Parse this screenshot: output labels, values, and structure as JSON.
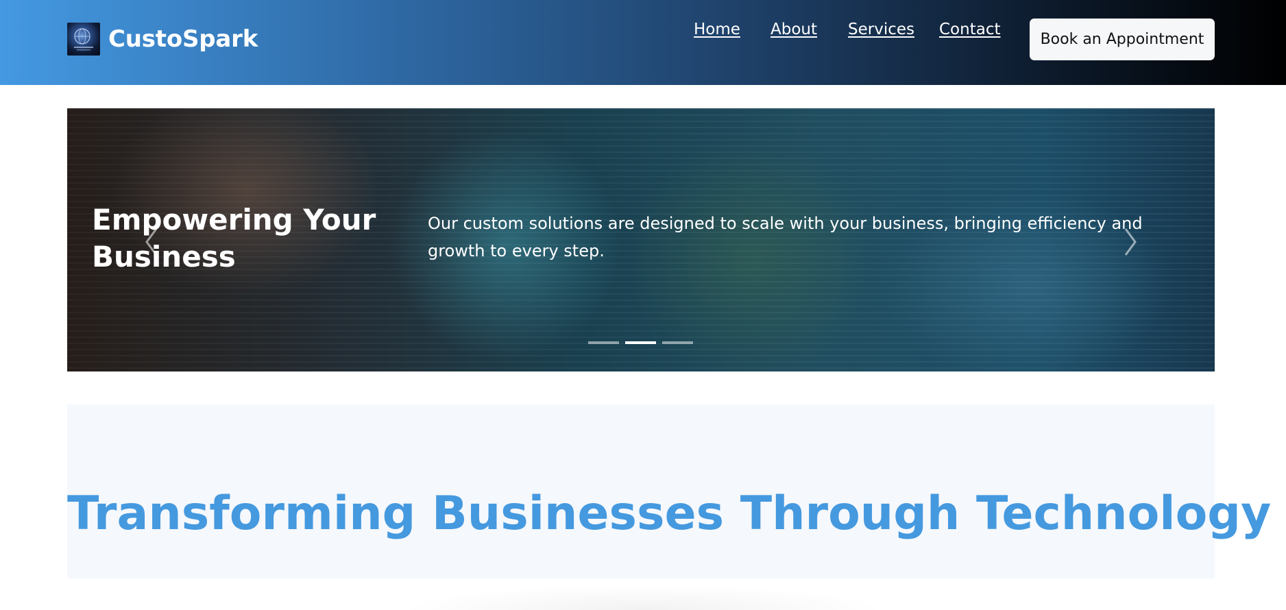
{
  "brand": {
    "name": "CustoSpark",
    "logo_icon": "globe-logo-icon"
  },
  "nav": {
    "items": [
      {
        "label": "Home"
      },
      {
        "label": "About"
      },
      {
        "label": "Services"
      },
      {
        "label": "Contact"
      }
    ],
    "cta_label": "Book an Appointment"
  },
  "hero": {
    "title": "Empowering Your Business",
    "description": "Our custom solutions are designed to scale with your business, bringing efficiency and growth to every step.",
    "slides_total": 3,
    "active_slide": 2,
    "prev_icon": "chevron-left-icon",
    "next_icon": "chevron-right-icon"
  },
  "intro": {
    "title": "Transforming Businesses Through Technology"
  },
  "colors": {
    "accent": "#4599df",
    "header_start": "#4499e2",
    "header_end": "#000000",
    "section_bg": "#f5f8fc"
  }
}
